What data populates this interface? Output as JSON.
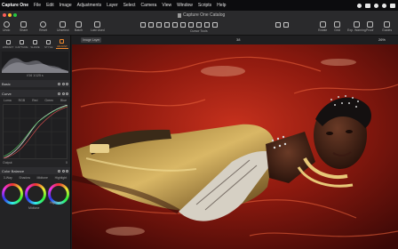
{
  "menubar": {
    "app": "Capture One",
    "items": [
      "File",
      "Edit",
      "Image",
      "Adjustments",
      "Layer",
      "Select",
      "Camera",
      "View",
      "Window",
      "Scripts",
      "Help"
    ]
  },
  "window": {
    "title": "Capture One Catalog"
  },
  "toolbar": {
    "left": [
      {
        "label": "Undo"
      },
      {
        "label": "Redo"
      },
      {
        "label": "Share"
      }
    ],
    "left_items": [
      "Undo",
      "Share",
      "Reset",
      "Unselect",
      "Batch",
      "Last Used"
    ],
    "cursor_label": "Cursor Tools",
    "right": [
      "Rotate",
      "Grid",
      "Exp. Warning",
      "Proof",
      "Guides",
      "Export"
    ]
  },
  "left_panel": {
    "tabs": [
      "LIBRARY",
      "CAPTURE",
      "SHARE",
      "STYLE",
      "ADJUST"
    ],
    "active_tab": "ADJUST",
    "exif": "f/16  1/125 s",
    "sections": [
      "Basic",
      "Curve",
      "Color Balance"
    ],
    "curve_tabs": [
      "Luma",
      "RGB",
      "Red",
      "Green",
      "Blue"
    ],
    "output_label": "Output",
    "output_value": "0",
    "wheel_tabs": [
      "3-Way",
      "Master",
      "Shadow",
      "Midtone",
      "Highlight"
    ],
    "wheel_labels": [
      "Midtone",
      "Highlight"
    ]
  },
  "viewer": {
    "layer_tag": "Image Layer",
    "counter": "38",
    "zoom": "26%"
  },
  "colors": {
    "accent": "#f08a2e"
  }
}
